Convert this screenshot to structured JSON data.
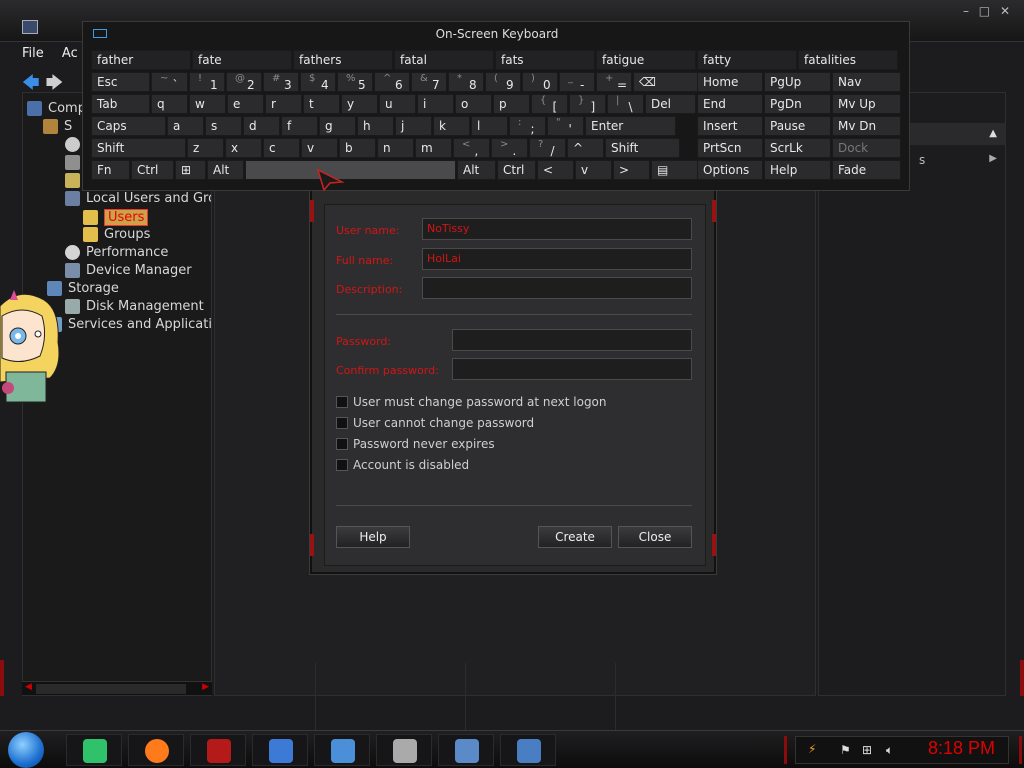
{
  "mmc": {
    "menu": [
      "File",
      "Ac"
    ],
    "window_controls": [
      "–",
      "□",
      "✕"
    ],
    "tree": [
      {
        "label": "Comp",
        "indent": 0
      },
      {
        "label": "S",
        "indent": 1
      },
      {
        "label": "",
        "indent": 2
      },
      {
        "label": "",
        "indent": 2
      },
      {
        "label": "",
        "indent": 2
      },
      {
        "label": "Local Users and Grou",
        "indent": 2
      },
      {
        "label": "Users",
        "indent": 3,
        "selected": true
      },
      {
        "label": "Groups",
        "indent": 3
      },
      {
        "label": "Performance",
        "indent": 2
      },
      {
        "label": "Device Manager",
        "indent": 2
      },
      {
        "label": "Storage",
        "indent": 1
      },
      {
        "label": "Disk Management",
        "indent": 2
      },
      {
        "label": "Services and Applications",
        "indent": 1
      }
    ],
    "actions_more_label": "s"
  },
  "osk": {
    "title": "On-Screen Keyboard",
    "suggestions": [
      "father",
      "fate",
      "fathers",
      "fatal",
      "fats",
      "fatigue",
      "fatty",
      "fatalities"
    ],
    "row1": [
      {
        "main": "Esc"
      },
      {
        "main": "`",
        "sub": "~"
      },
      {
        "main": "1",
        "sub": "!"
      },
      {
        "main": "2",
        "sub": "@"
      },
      {
        "main": "3",
        "sub": "#"
      },
      {
        "main": "4",
        "sub": "$"
      },
      {
        "main": "5",
        "sub": "%"
      },
      {
        "main": "6",
        "sub": "^"
      },
      {
        "main": "7",
        "sub": "&"
      },
      {
        "main": "8",
        "sub": "*"
      },
      {
        "main": "9",
        "sub": "("
      },
      {
        "main": "0",
        "sub": ")"
      },
      {
        "main": "-",
        "sub": "_"
      },
      {
        "main": "=",
        "sub": "+"
      },
      {
        "main": "⌫"
      }
    ],
    "row2": [
      "Tab",
      "q",
      "w",
      "e",
      "r",
      "t",
      "y",
      "u",
      "i",
      "o",
      "p",
      "[",
      "]",
      "\\",
      "Del"
    ],
    "row2_subs": {
      "[": "{",
      "]": "}",
      "\\": "|"
    },
    "row3": [
      "Caps",
      "a",
      "s",
      "d",
      "f",
      "g",
      "h",
      "j",
      "k",
      "l",
      ";",
      "'",
      "Enter"
    ],
    "row3_subs": {
      ";": ":",
      "'": "\""
    },
    "row4": [
      "Shift",
      "z",
      "x",
      "c",
      "v",
      "b",
      "n",
      "m",
      ",",
      ".",
      "/",
      "^",
      "Shift"
    ],
    "row4_subs": {
      ",": "<",
      ".": ">",
      "/": "?"
    },
    "row5": [
      "Fn",
      "Ctrl",
      "⊞",
      "Alt",
      "",
      "Alt",
      "Ctrl",
      "<",
      "v",
      ">",
      "▤"
    ],
    "nav": [
      [
        "Home",
        "PgUp",
        "Nav"
      ],
      [
        "End",
        "PgDn",
        "Mv Up"
      ],
      [
        "Insert",
        "Pause",
        "Mv Dn"
      ],
      [
        "PrtScn",
        "ScrLk",
        "Dock"
      ],
      [
        "Options",
        "Help",
        "Fade"
      ]
    ]
  },
  "dialog": {
    "labels": {
      "user_name": "User name:",
      "full_name": "Full name:",
      "description": "Description:",
      "password": "Password:",
      "confirm_password": "Confirm password:"
    },
    "values": {
      "user_name": "NoTissy",
      "full_name": "HolLai",
      "description": "",
      "password": "",
      "confirm_password": ""
    },
    "checkboxes": [
      {
        "label": "User must change password at next logon",
        "checked": false
      },
      {
        "label": "User cannot change password",
        "checked": false
      },
      {
        "label": "Password never expires",
        "checked": false
      },
      {
        "label": "Account is disabled",
        "checked": false
      }
    ],
    "buttons": {
      "help": "Help",
      "create": "Create",
      "close": "Close"
    }
  },
  "taskbar": {
    "clock": "8:18 PM",
    "apps": [
      "notes",
      "firefox",
      "video-cam",
      "monitor",
      "window",
      "server",
      "computer",
      "keyboard"
    ],
    "colors": {
      "notes": "#2fc26a",
      "firefox": "#ff7a1a",
      "video-cam": "#b51a1a",
      "monitor": "#3d7ad6",
      "window": "#4b8fd8",
      "server": "#aaaaaa",
      "computer": "#5a8ac8",
      "keyboard": "#4a7ec2"
    }
  }
}
